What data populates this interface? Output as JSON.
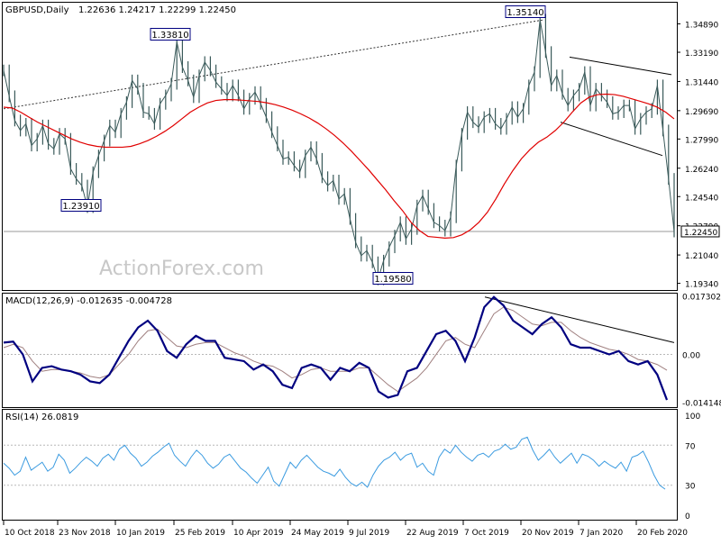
{
  "header": {
    "symbol": "GBPUSD,Daily",
    "ohlc": "1.22636 1.24217 1.22299 1.22450"
  },
  "watermark": "ActionForex.com",
  "colors": {
    "price": "#3a5a5a",
    "ma": "#e00000",
    "grid": "#b8b8b8",
    "macd": "#000080",
    "signal": "#a08080",
    "rsi": "#3b9be0",
    "trend": "#000000",
    "label_border": "#000080"
  },
  "chart_data": [
    {
      "type": "line",
      "name": "price",
      "title": "GBPUSD,Daily",
      "ylim": [
        1.1894,
        1.3616
      ],
      "y_ticks": [
        "1.34890",
        "1.33190",
        "1.31440",
        "1.29690",
        "1.27990",
        "1.26240",
        "1.24540",
        "1.22790",
        "1.21040",
        "1.19340"
      ],
      "x_labels": [
        "10 Oct 2018",
        "23 Nov 2018",
        "10 Jan 2019",
        "25 Feb 2019",
        "10 Apr 2019",
        "24 May 2019",
        "9 Jul 2019",
        "22 Aug 2019",
        "7 Oct 2019",
        "20 Nov 2019",
        "7 Jan 2020",
        "20 Feb 2020"
      ],
      "current_price": "1.22450",
      "annotations": [
        {
          "text": "1.33810",
          "value": 1.3381
        },
        {
          "text": "1.23910",
          "value": 1.2391
        },
        {
          "text": "1.19580",
          "value": 1.1958
        },
        {
          "text": "1.35140",
          "value": 1.3514
        }
      ],
      "series": [
        {
          "name": "GBPUSD",
          "values": [
            1.321,
            1.3055,
            1.291,
            1.285,
            1.289,
            1.276,
            1.28,
            1.288,
            1.277,
            1.274,
            1.283,
            1.28,
            1.262,
            1.256,
            1.252,
            1.2391,
            1.26,
            1.27,
            1.279,
            1.288,
            1.284,
            1.295,
            1.302,
            1.315,
            1.31,
            1.296,
            1.295,
            1.289,
            1.301,
            1.306,
            1.313,
            1.3381,
            1.323,
            1.315,
            1.305,
            1.318,
            1.326,
            1.321,
            1.314,
            1.31,
            1.306,
            1.312,
            1.306,
            1.298,
            1.304,
            1.308,
            1.301,
            1.293,
            1.284,
            1.276,
            1.268,
            1.269,
            1.264,
            1.26,
            1.27,
            1.275,
            1.268,
            1.257,
            1.252,
            1.255,
            1.244,
            1.247,
            1.232,
            1.218,
            1.21,
            1.213,
            1.206,
            1.1958,
            1.207,
            1.215,
            1.222,
            1.23,
            1.22,
            1.226,
            1.24,
            1.246,
            1.238,
            1.23,
            1.228,
            1.225,
            1.233,
            1.264,
            1.283,
            1.296,
            1.29,
            1.287,
            1.293,
            1.295,
            1.289,
            1.286,
            1.292,
            1.299,
            1.293,
            1.298,
            1.312,
            1.32,
            1.3514,
            1.332,
            1.312,
            1.318,
            1.307,
            1.3,
            1.306,
            1.31,
            1.32,
            1.3,
            1.31,
            1.306,
            1.302,
            1.295,
            1.296,
            1.3,
            1.3,
            1.286,
            1.292,
            1.296,
            1.298,
            1.312,
            1.285,
            1.256,
            1.2245
          ]
        },
        {
          "name": "MA",
          "values": [
            1.299,
            1.2985,
            1.296,
            1.293,
            1.29,
            1.2875,
            1.285,
            1.2825,
            1.28,
            1.278,
            1.2765,
            1.2755,
            1.275,
            1.275,
            1.275,
            1.2755,
            1.277,
            1.279,
            1.2815,
            1.2845,
            1.288,
            1.292,
            1.296,
            1.299,
            1.3015,
            1.303,
            1.3035,
            1.3035,
            1.3032,
            1.3028,
            1.3024,
            1.3016,
            1.3005,
            1.299,
            1.2972,
            1.295,
            1.2925,
            1.2895,
            1.286,
            1.282,
            1.2775,
            1.2725,
            1.267,
            1.2615,
            1.2555,
            1.2495,
            1.243,
            1.237,
            1.23,
            1.225,
            1.2215,
            1.221,
            1.2205,
            1.2208,
            1.2225,
            1.2255,
            1.23,
            1.236,
            1.244,
            1.253,
            1.261,
            1.268,
            1.2735,
            1.278,
            1.281,
            1.285,
            1.29,
            1.296,
            1.3015,
            1.305,
            1.3065,
            1.3068,
            1.3065,
            1.3055,
            1.304,
            1.3025,
            1.301,
            1.299,
            1.296,
            1.292
          ]
        }
      ],
      "trendlines": [
        {
          "name": "rising-dotted",
          "from": 1.298,
          "to": 1.3514,
          "style": "dotted"
        },
        {
          "name": "channel-upper",
          "from": 1.329,
          "to": 1.3185
        },
        {
          "name": "channel-lower",
          "from": 1.29,
          "to": 1.27
        }
      ],
      "grid": false
    },
    {
      "type": "line",
      "name": "macd",
      "title": "MACD(12,26,9) -0.012635 -0.004728",
      "ylim": [
        -0.01562,
        0.01801
      ],
      "y_ticks": [
        "0.017302",
        "0.00",
        "-0.014148"
      ],
      "series": [
        {
          "name": "MACD",
          "values": [
            0.0035,
            0.0038,
            0.0,
            -0.008,
            -0.004,
            -0.0035,
            -0.0045,
            -0.005,
            -0.006,
            -0.008,
            -0.0085,
            -0.006,
            -0.001,
            0.004,
            0.008,
            0.01,
            0.007,
            0.001,
            -0.001,
            0.003,
            0.0055,
            0.004,
            0.004,
            -0.001,
            -0.0015,
            -0.002,
            -0.0045,
            -0.003,
            -0.005,
            -0.009,
            -0.01,
            -0.004,
            -0.003,
            -0.004,
            -0.0075,
            -0.004,
            -0.005,
            -0.0025,
            -0.004,
            -0.011,
            -0.0128,
            -0.012,
            -0.005,
            -0.004,
            0.001,
            0.006,
            0.007,
            0.004,
            -0.002,
            0.005,
            0.014,
            0.017,
            0.0145,
            0.01,
            0.008,
            0.006,
            0.009,
            0.011,
            0.008,
            0.003,
            0.002,
            0.002,
            0.001,
            0.0,
            0.001,
            -0.002,
            -0.003,
            -0.002,
            -0.006,
            -0.0135
          ]
        },
        {
          "name": "Signal",
          "values": [
            0.002,
            0.003,
            0.002,
            -0.002,
            -0.005,
            -0.0045,
            -0.0045,
            -0.005,
            -0.0055,
            -0.0065,
            -0.007,
            -0.006,
            -0.003,
            0.0,
            0.004,
            0.007,
            0.0075,
            0.005,
            0.0025,
            0.002,
            0.003,
            0.0035,
            0.0035,
            0.002,
            0.0005,
            -0.0005,
            -0.002,
            -0.003,
            -0.0035,
            -0.005,
            -0.007,
            -0.006,
            -0.0045,
            -0.004,
            -0.005,
            -0.005,
            -0.005,
            -0.004,
            -0.004,
            -0.0065,
            -0.009,
            -0.011,
            -0.009,
            -0.007,
            -0.004,
            0.0,
            0.004,
            0.005,
            0.003,
            0.002,
            0.007,
            0.012,
            0.014,
            0.013,
            0.011,
            0.009,
            0.0085,
            0.0095,
            0.0095,
            0.007,
            0.005,
            0.0035,
            0.0025,
            0.0015,
            0.001,
            0.0,
            -0.0015,
            -0.002,
            -0.003,
            -0.0047
          ]
        }
      ],
      "trendline": {
        "from": 0.017,
        "to": 0.0035
      },
      "grid": false
    },
    {
      "type": "line",
      "name": "rsi",
      "title": "RSI(14) 26.0819",
      "ylim": [
        0,
        100
      ],
      "y_ticks": [
        "100",
        "70",
        "30",
        "0"
      ],
      "levels": [
        70,
        30
      ],
      "series": [
        {
          "name": "RSI",
          "values": [
            52,
            47,
            40,
            44,
            58,
            45,
            49,
            53,
            44,
            48,
            61,
            55,
            42,
            47,
            53,
            58,
            54,
            49,
            57,
            61,
            55,
            66,
            70,
            62,
            57,
            49,
            53,
            59,
            63,
            68,
            72,
            60,
            54,
            49,
            58,
            65,
            60,
            52,
            47,
            51,
            58,
            61,
            54,
            47,
            43,
            37,
            32,
            40,
            48,
            34,
            29,
            41,
            53,
            47,
            55,
            60,
            54,
            48,
            44,
            42,
            39,
            46,
            38,
            32,
            29,
            33,
            28,
            40,
            49,
            55,
            58,
            63,
            55,
            60,
            62,
            48,
            52,
            44,
            40,
            58,
            66,
            62,
            70,
            63,
            58,
            54,
            60,
            62,
            58,
            64,
            66,
            71,
            66,
            68,
            76,
            78,
            65,
            55,
            60,
            66,
            58,
            52,
            57,
            62,
            52,
            61,
            59,
            55,
            49,
            54,
            50,
            47,
            53,
            44,
            58,
            60,
            64,
            53,
            40,
            30,
            26
          ]
        }
      ],
      "grid": false
    }
  ]
}
